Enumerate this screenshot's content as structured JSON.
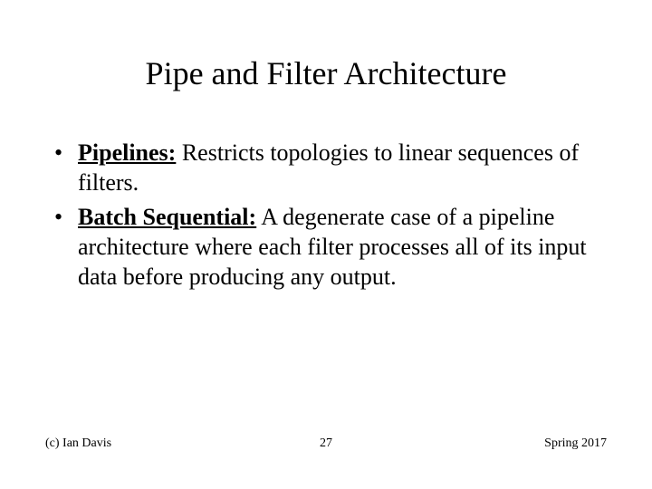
{
  "title": "Pipe and Filter Architecture",
  "bullets": [
    {
      "term": "Pipelines:",
      "text": "  Restricts topologies to linear sequences of filters."
    },
    {
      "term": "Batch Sequential:",
      "text": " A degenerate case of a pipeline architecture where each filter processes all of its input data before producing any output."
    }
  ],
  "footer": {
    "left": "(c) Ian Davis",
    "center": "27",
    "right": "Spring 2017"
  }
}
